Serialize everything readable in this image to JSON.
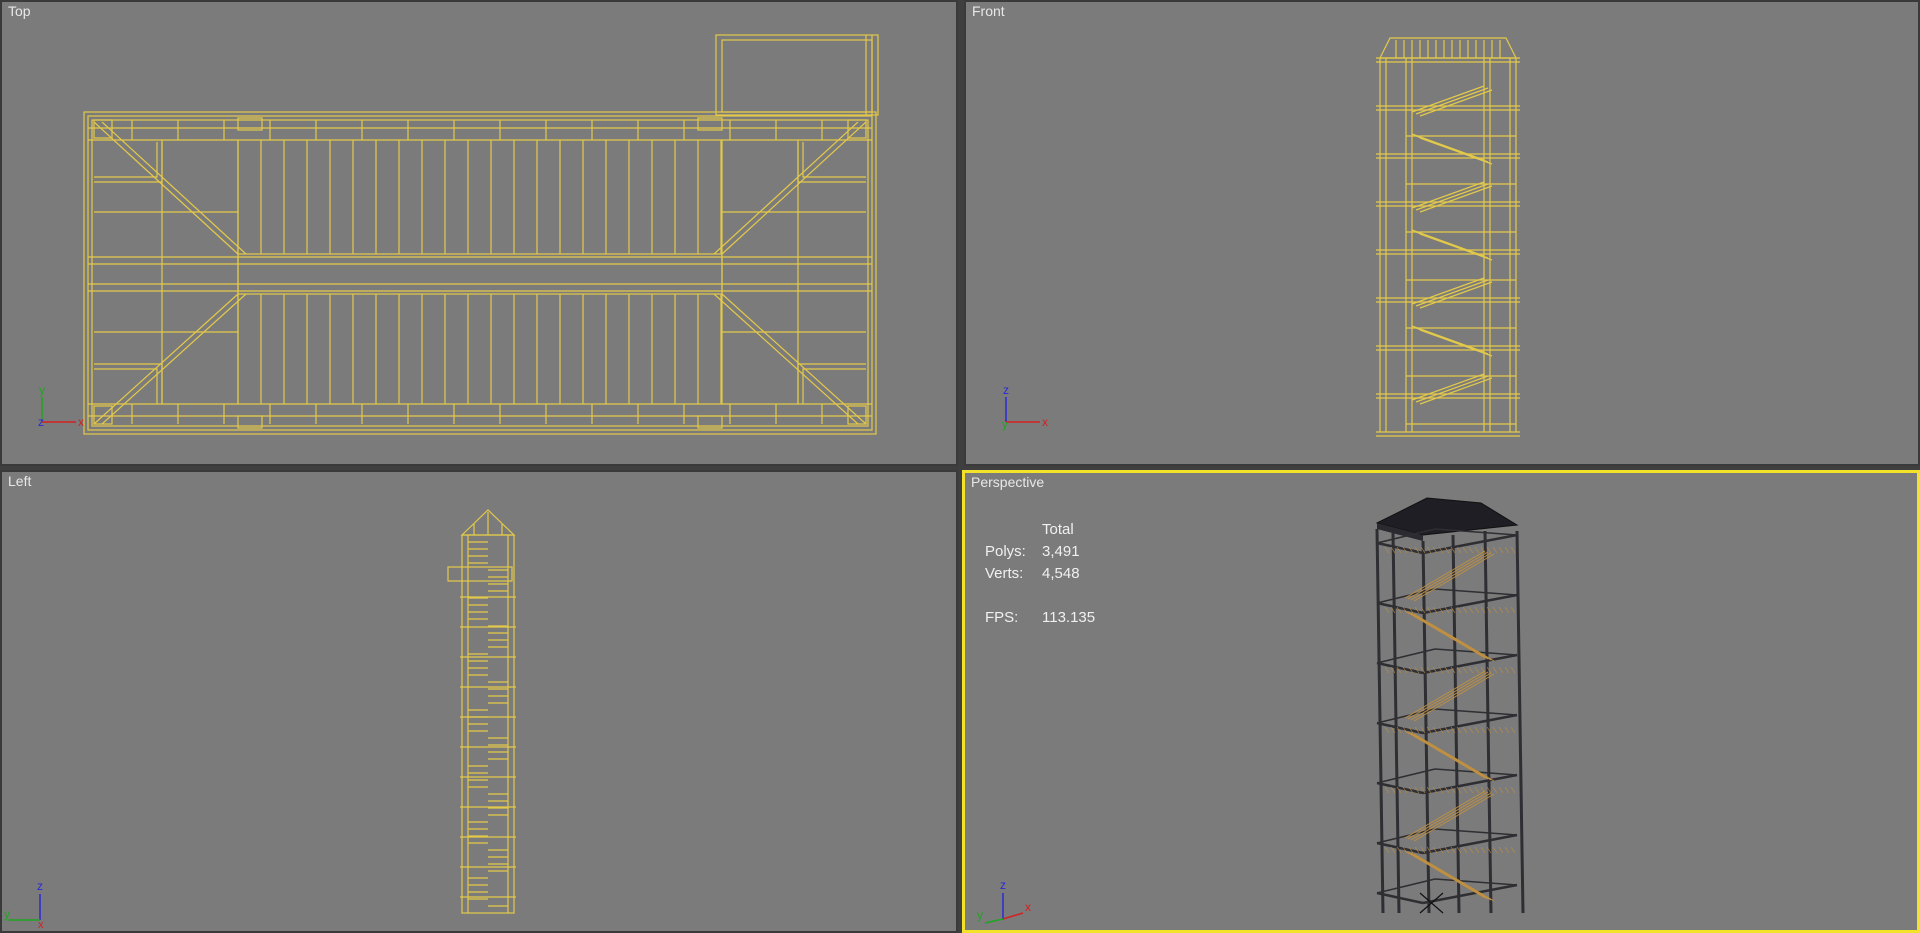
{
  "viewports": {
    "top": {
      "label": "Top"
    },
    "front": {
      "label": "Front"
    },
    "left": {
      "label": "Left"
    },
    "perspective": {
      "label": "Perspective"
    }
  },
  "stats": {
    "header": "Total",
    "polys_label": "Polys:",
    "polys_value": "3,491",
    "verts_label": "Verts:",
    "verts_value": "4,548",
    "fps_label": "FPS:",
    "fps_value": "113.135"
  },
  "axes": {
    "x": "x",
    "y": "y",
    "z": "z",
    "x_color": "#d42020",
    "y_color": "#1fa51f",
    "z_color": "#2a2ad8"
  },
  "colors": {
    "viewport_bg": "#7b7b7b",
    "wireframe": "#e3c94a",
    "active_border": "#f2e22a",
    "frame": "#3a3a3a"
  }
}
